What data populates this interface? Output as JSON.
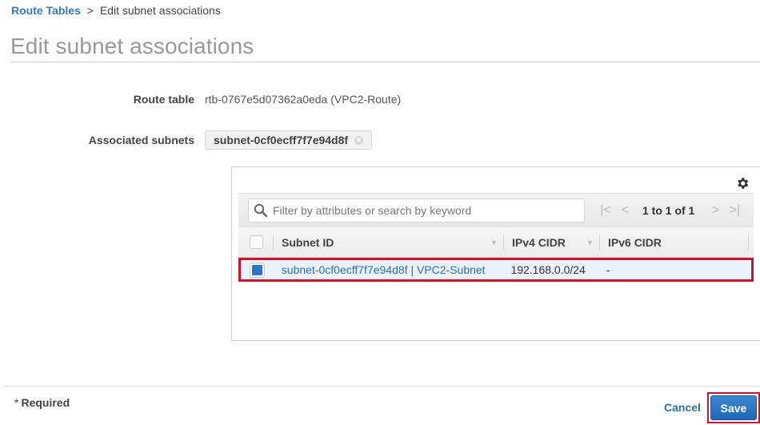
{
  "breadcrumb": {
    "parent": "Route Tables",
    "separator": ">",
    "current": "Edit subnet associations"
  },
  "page_title": "Edit subnet associations",
  "form": {
    "route_table": {
      "label": "Route table",
      "value": "rtb-0767e5d07362a0eda (VPC2-Route)"
    },
    "associated_subnets": {
      "label": "Associated subnets",
      "tokens": [
        {
          "label": "subnet-0cf0ecff7f7e94d8f",
          "remove_icon": "close-circle-icon"
        }
      ]
    }
  },
  "table": {
    "settings_icon": "gear-icon",
    "search": {
      "placeholder": "Filter by attributes or search by keyword",
      "value": ""
    },
    "pagination": {
      "text": "1 to 1 of 1",
      "first_icon": "|<",
      "prev_icon": "<",
      "next_icon": ">",
      "last_icon": ">|"
    },
    "columns": [
      {
        "label": "Subnet ID",
        "sortable": true
      },
      {
        "label": "IPv4 CIDR",
        "sortable": true
      },
      {
        "label": "IPv6 CIDR",
        "sortable": false
      }
    ],
    "rows": [
      {
        "selected": true,
        "subnet": "subnet-0cf0ecff7f7e94d8f | VPC2-Subnet",
        "ipv4": "192.168.0.0/24",
        "ipv6": "-"
      }
    ]
  },
  "footer": {
    "required_asterisk": "*",
    "required_label": "Required",
    "cancel_label": "Cancel",
    "save_label": "Save"
  },
  "colors": {
    "link": "#337ab7",
    "primary_button": "#1f66b4",
    "highlight_outline": "#c7172d",
    "selected_row": "#eaf3fc"
  }
}
